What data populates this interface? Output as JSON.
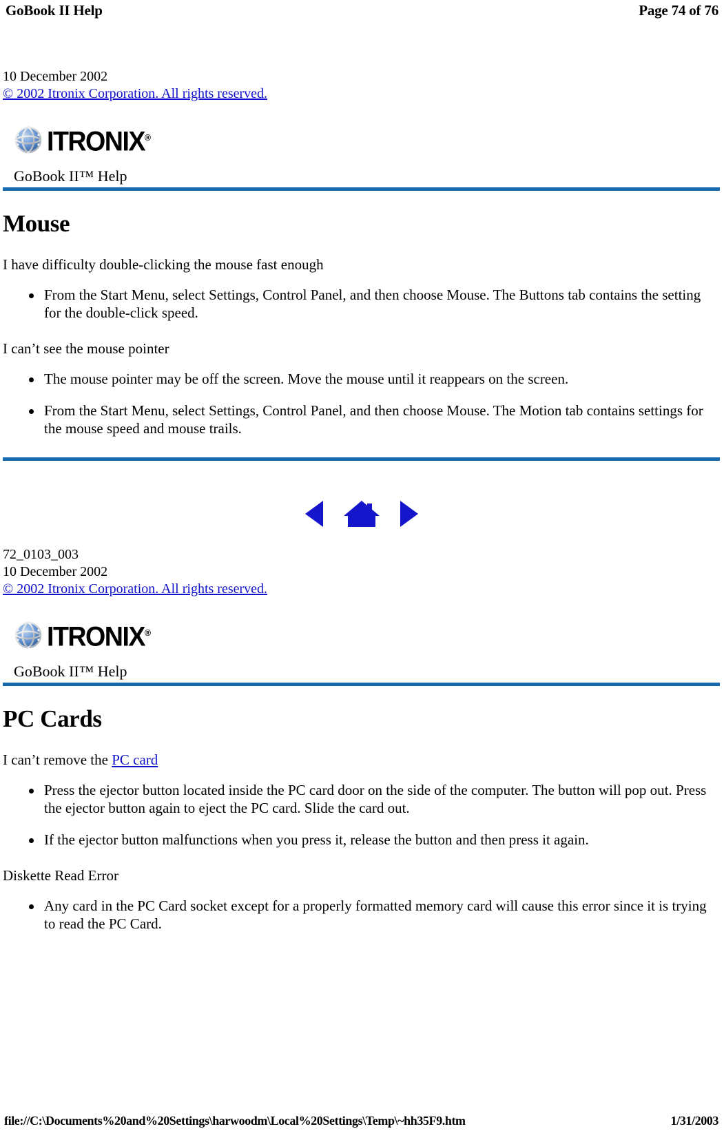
{
  "print_header": {
    "left": "GoBook II Help",
    "right": "Page 74 of 76"
  },
  "print_footer": {
    "url": "file://C:\\Documents%20and%20Settings\\harwoodm\\Local%20Settings\\Temp\\~hh35F9.htm",
    "date": "1/31/2003"
  },
  "section_one": {
    "meta": {
      "date_line": "10 December 2002",
      "copyright_link": "© 2002 Itronix Corporation.  All rights reserved."
    },
    "logo": {
      "wordmark": "ITRONIX",
      "registered_mark": "®",
      "globe_color": "#5b8fd4",
      "globe_mesh_color": "#d9dde2"
    },
    "help_title": "GoBook II™ Help",
    "rule_color": "#1569ae",
    "heading": "Mouse",
    "blocks": [
      {
        "lead": "I have difficulty double-clicking the mouse fast enough",
        "bullets": [
          "From the Start Menu, select Settings, Control Panel, and then choose Mouse.  The Buttons tab contains the setting for the double-click speed."
        ]
      },
      {
        "lead": "I can’t see the mouse pointer",
        "bullets": [
          "The mouse pointer may be off the screen. Move the mouse until it reappears on the screen.",
          "From the Start Menu, select Settings, Control Panel, and then choose Mouse.  The Motion tab contains settings for the mouse speed and mouse trails."
        ]
      }
    ]
  },
  "navigation": {
    "back_label": "Back",
    "home_label": "Home",
    "forward_label": "Forward",
    "icon_color": "#1515cc"
  },
  "section_two": {
    "meta": {
      "doc_number": "72_0103_003",
      "date_line": "10 December 2002",
      "copyright_link": "© 2002 Itronix Corporation.  All rights reserved."
    },
    "logo": {
      "wordmark": "ITRONIX",
      "registered_mark": "®"
    },
    "help_title": "GoBook II™ Help",
    "heading": "PC Cards",
    "lead_prefix": "I can’t remove the ",
    "lead_link": "PC card",
    "bullets": [
      "Press the ejector button located inside the PC card door on the side of the computer. The button will pop out. Press the ejector button again to eject the PC card.  Slide the card out.",
      "If the ejector button malfunctions when you press it, release the button and then press it again."
    ],
    "lead_two": "Diskette Read Error",
    "bullets_two": [
      "Any card in the PC Card socket except for a properly formatted memory card will cause this error since it is trying to read the PC Card."
    ]
  }
}
